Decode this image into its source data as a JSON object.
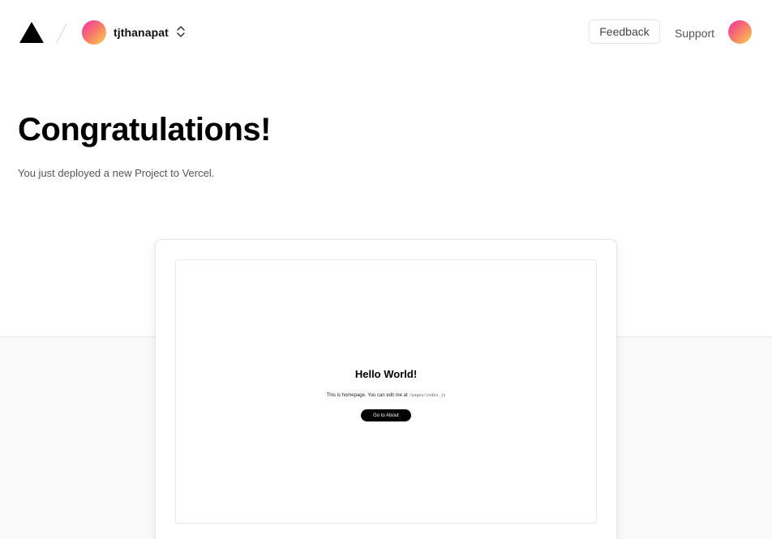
{
  "header": {
    "team_name": "tjthanapat",
    "feedback_label": "Feedback",
    "support_label": "Support"
  },
  "hero": {
    "title": "Congratulations!",
    "subtitle": "You just deployed a new Project to Vercel."
  },
  "preview": {
    "title": "Hello World!",
    "text": "This is homepage. You can edit me at",
    "path": "/pages/index.js",
    "button_label": "Go to About"
  },
  "icons": {
    "logo": "vercel-triangle-icon",
    "switcher": "chevron-up-down-icon"
  },
  "colors": {
    "avatar_gradient": [
      "#f12fa5",
      "#f77a6a",
      "#f8d54c"
    ],
    "band_background": "#fafafa"
  }
}
